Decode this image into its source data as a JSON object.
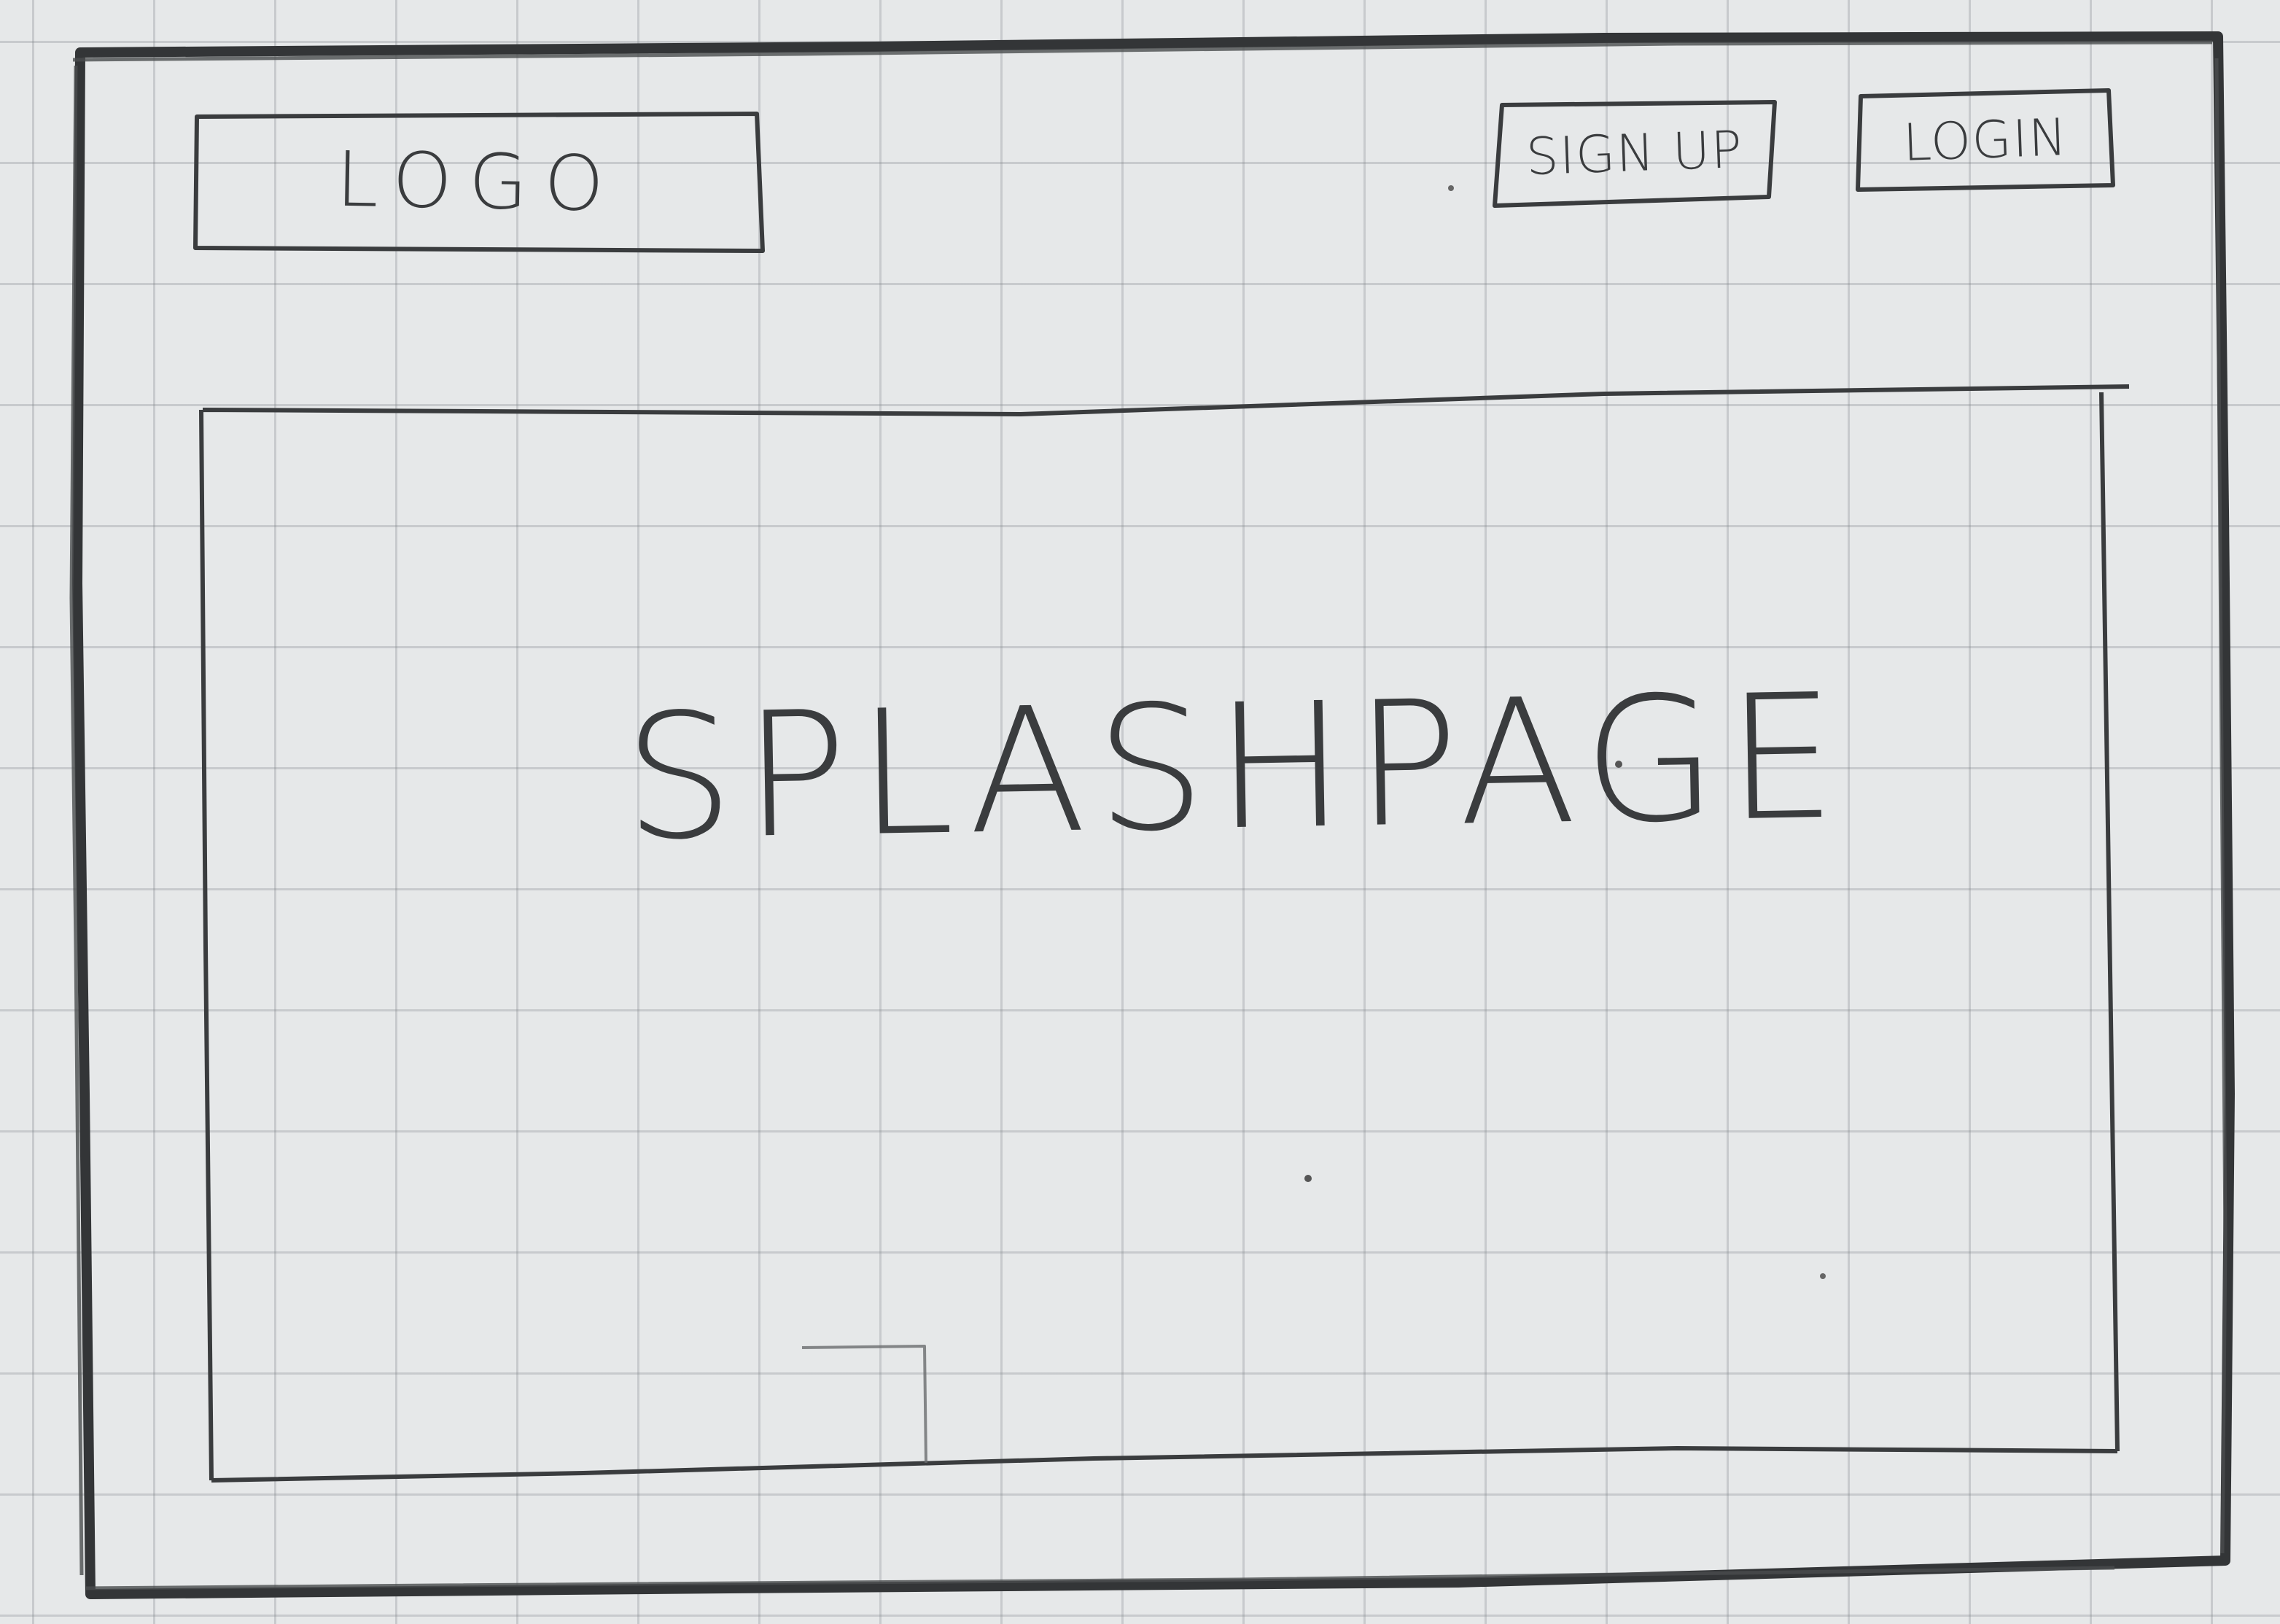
{
  "header": {
    "logo_label": "LOGO",
    "signup_label": "SIGN UP",
    "login_label": "LOGIN"
  },
  "main": {
    "splash_label": "SPLASHPAGE"
  },
  "colors": {
    "paper": "#e6e8e9",
    "pencil": "#3a3c3e",
    "grid": "#9ea3a8"
  }
}
